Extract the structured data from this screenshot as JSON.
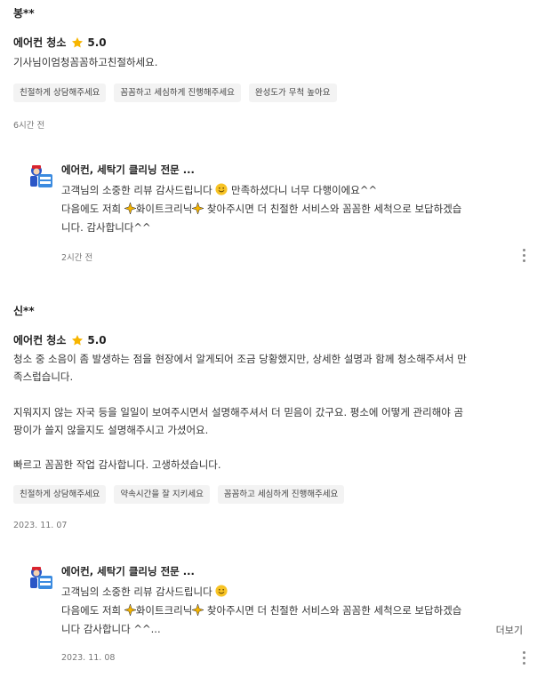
{
  "reviews": [
    {
      "author": "봉**",
      "service": "에어컨 청소",
      "rating": "5.0",
      "body": "기사님이엄청꼼꼼하고친절하세요.",
      "tags": [
        "친절하게 상담해주세요",
        "꼼꼼하고 세심하게 진행해주세요",
        "완성도가 무척 높아요"
      ],
      "date": "6시간 전",
      "reply": {
        "name": "에어컨, 세탁기 클리닝 전문 ...",
        "line1_a": "고객님의 소중한 리뷰 감사드립니다 ",
        "line1_b": " 만족하셨다니 너무 다행이에요^^",
        "line2_a": "다음에도 저희 ",
        "line2_b": "화이트크리닉",
        "line2_c": " 찾아주시면 더 친절한 서비스와 꼼꼼한 세척으로 보답하겠습",
        "line3": "니다. 감사합니다^^",
        "date": "2시간 전"
      }
    },
    {
      "author": "신**",
      "service": "에어컨 청소",
      "rating": "5.0",
      "body_p1_l1": "청소 중 소음이 좀 발생하는 점을 현장에서 알게되어 조금 당황했지만, 상세한 설명과 함께 청소해주셔서 만",
      "body_p1_l2": "족스럽습니다.",
      "body_p2_l1": "지워지지 않는 자국 등을 일일이 보여주시면서 설명해주셔서 더 믿음이 갔구요. 평소에 어떻게 관리해야 곰",
      "body_p2_l2": "팡이가 쓸지 않을지도 설명해주시고 가셨어요.",
      "body_p3": "빠르고 꼼꼼한 작업 감사합니다. 고생하셨습니다.",
      "tags": [
        "친절하게 상담해주세요",
        "약속시간을 잘 지키세요",
        "꼼꼼하고 세심하게 진행해주세요"
      ],
      "date": "2023. 11. 07",
      "reply": {
        "name": "에어컨, 세탁기 클리닝 전문 ...",
        "line1_a": "고객님의 소중한 리뷰 감사드립니다 ",
        "line2_a": "다음에도 저희 ",
        "line2_b": "화이트크리닉",
        "line2_c": " 찾아주시면 더 친절한 서비스와 꼼꼼한 세척으로 보답하겠습",
        "line3": "니다 감사합니다 ^^...",
        "more": "더보기",
        "date": "2023. 11. 08"
      }
    }
  ],
  "icons": {
    "star": "star-icon",
    "emoji": "smiling-face-icon",
    "sparkle": "sparkle-icon",
    "menu": "more-options-icon",
    "logo": "white-clinic-logo"
  },
  "colors": {
    "star": "#f7b500",
    "tag_bg": "#f3f3f3",
    "date": "#777777"
  }
}
